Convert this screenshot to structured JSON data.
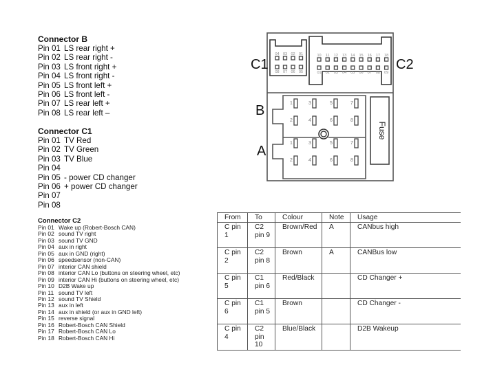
{
  "connector_b": {
    "title": "Connector B",
    "pins": [
      {
        "pin": "Pin 01",
        "desc": "LS rear right +"
      },
      {
        "pin": "Pin 02",
        "desc": "LS rear right -"
      },
      {
        "pin": "Pin 03",
        "desc": "LS front right +"
      },
      {
        "pin": "Pin 04",
        "desc": "LS front right -"
      },
      {
        "pin": "Pin 05",
        "desc": "LS front left +"
      },
      {
        "pin": "Pin 06",
        "desc": "LS front left -"
      },
      {
        "pin": "Pin 07",
        "desc": "LS rear left +"
      },
      {
        "pin": "Pin 08",
        "desc": "LS rear left –"
      }
    ]
  },
  "connector_c1": {
    "title": "Connector C1",
    "pins": [
      {
        "pin": "Pin 01",
        "desc": "TV Red"
      },
      {
        "pin": "Pin 02",
        "desc": "TV Green"
      },
      {
        "pin": "Pin 03",
        "desc": "TV Blue"
      },
      {
        "pin": "Pin 04",
        "desc": ""
      },
      {
        "pin": "Pin 05",
        "desc": "- power CD changer"
      },
      {
        "pin": "Pin 06",
        "desc": "+ power CD changer"
      },
      {
        "pin": "Pin 07",
        "desc": ""
      },
      {
        "pin": "Pin 08",
        "desc": ""
      }
    ]
  },
  "connector_c2": {
    "title": "Connector C2",
    "pins": [
      {
        "pin": "Pin 01",
        "desc": "Wake up (Robert-Bosch CAN)"
      },
      {
        "pin": "Pin 02",
        "desc": "sound TV right"
      },
      {
        "pin": "Pin 03",
        "desc": "sound TV GND"
      },
      {
        "pin": "Pin 04",
        "desc": "aux in right"
      },
      {
        "pin": "Pin 05",
        "desc": "aux in GND (right)"
      },
      {
        "pin": "Pin 06",
        "desc": "speedsensor (non-CAN)"
      },
      {
        "pin": "Pin 07",
        "desc": "interior CAN shield"
      },
      {
        "pin": "Pin 08",
        "desc": "interior CAN Lo (buttons on steering wheel, etc)"
      },
      {
        "pin": "Pin 09",
        "desc": "interior CAN Hi (buttons on steering wheel, etc)"
      },
      {
        "pin": "Pin 10",
        "desc": "D2B Wake up"
      },
      {
        "pin": "Pin 11",
        "desc": "sound TV left"
      },
      {
        "pin": "Pin 12",
        "desc": "sound TV Shield"
      },
      {
        "pin": "Pin 13",
        "desc": "aux in left"
      },
      {
        "pin": "Pin 14",
        "desc": "aux in shield (or aux in GND left)"
      },
      {
        "pin": "Pin 15",
        "desc": "reverse signal"
      },
      {
        "pin": "Pin 16",
        "desc": "Robert-Bosch CAN Shield"
      },
      {
        "pin": "Pin 17",
        "desc": "Robert-Bosch CAN Lo"
      },
      {
        "pin": "Pin 18",
        "desc": "Robert-Bosch CAN Hi"
      }
    ]
  },
  "wiring_table": {
    "headers": [
      "From",
      "To",
      "Colour",
      "Note",
      "Usage"
    ],
    "rows": [
      {
        "from": "C pin 1",
        "to": "C2 pin 9",
        "colour": "Brown/Red",
        "note": "A",
        "usage": "CANbus high"
      },
      {
        "from": "C pin 2",
        "to": "C2 pin 8",
        "colour": "Brown",
        "note": "A",
        "usage": "CANBus low"
      },
      {
        "from": "C pin 5",
        "to": "C1 pin 6",
        "colour": "Red/Black",
        "note": "",
        "usage": "CD Changer +"
      },
      {
        "from": "C pin 6",
        "to": "C1 pin 5",
        "colour": "Brown",
        "note": "",
        "usage": "CD Changer -"
      },
      {
        "from": "C pin 4",
        "to": "C2 pin 10",
        "colour": "Blue/Black",
        "note": "",
        "usage": "D2B Wakeup"
      }
    ]
  },
  "diagram": {
    "labels": {
      "c1": "C1",
      "c2": "C2",
      "b": "B",
      "a": "A",
      "fuse": "Fuse"
    },
    "c1_top_pins": [
      "04",
      "03",
      "02",
      "01"
    ],
    "c1_bottom_pins": [
      "08",
      "07",
      "06",
      "05"
    ],
    "c2_top_pins": [
      "10",
      "11",
      "12",
      "13",
      "14",
      "15",
      "16",
      "17",
      "18"
    ],
    "c2_bottom_pins": [
      "01",
      "02",
      "03",
      "04",
      "05",
      "06",
      "07",
      "08",
      "09"
    ],
    "ab_top_row": [
      "1",
      "3",
      "5",
      "7"
    ],
    "ab_bottom_row": [
      "2",
      "4",
      "6",
      "8"
    ]
  }
}
